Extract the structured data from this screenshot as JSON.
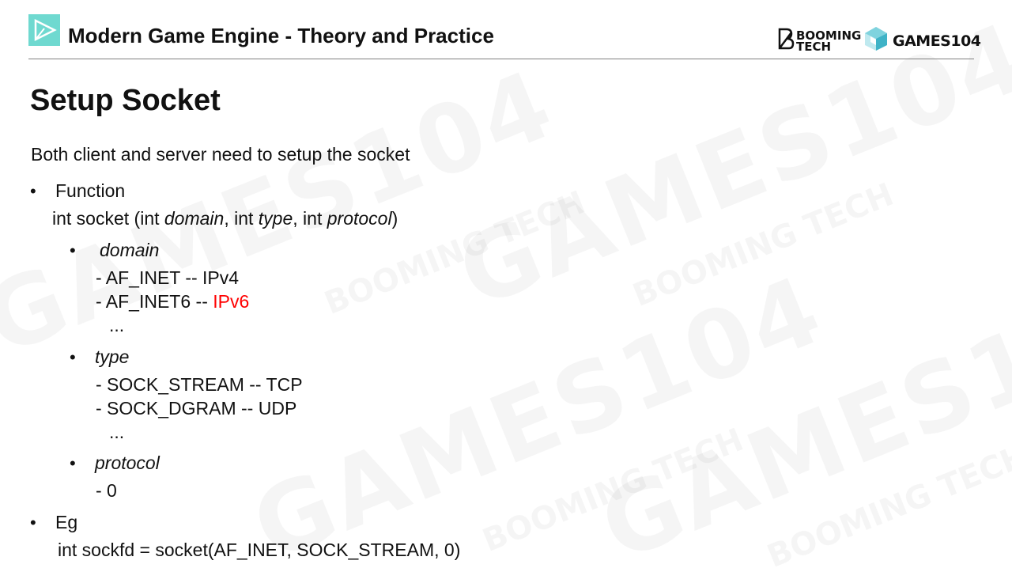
{
  "header": {
    "title": "Modern Game Engine - Theory and Practice",
    "brand_booming": "BOOMING\nTECH",
    "brand_games": "GAMES104"
  },
  "slide": {
    "title": "Setup Socket",
    "intro": "Both client and server need to setup the socket",
    "function_label": "Function",
    "signature": {
      "p1": "int socket (int ",
      "domain": "domain",
      "p2": ", int ",
      "type": "type",
      "p3": ", int ",
      "protocol": "protocol",
      "p4": ")"
    },
    "domain_label": "domain",
    "domain_items": {
      "inet": "- AF_INET -- IPv4",
      "inet6_prefix": "- AF_INET6 -- ",
      "inet6_value": "IPv6",
      "ellipsis": "..."
    },
    "type_label": "type",
    "type_items": {
      "stream": "- SOCK_STREAM -- TCP",
      "dgram": "- SOCK_DGRAM -- UDP",
      "ellipsis": "..."
    },
    "protocol_label": "protocol",
    "protocol_items": {
      "zero": "- 0"
    },
    "eg_label": "Eg",
    "eg_code": "int sockfd = socket(AF_INET, SOCK_STREAM, 0)"
  },
  "bullet_char": "•",
  "watermark": {
    "big": "GAMES104",
    "small": "BOOMING\nTECH"
  },
  "colors": {
    "accent_logo": "#6fd9d0",
    "highlight": "#ff0000",
    "rule": "#7f7f7f"
  },
  "icons": {
    "header_logo": "play-triangle-icon",
    "booming_logo": "booming-b-icon",
    "games_logo": "cube-icon"
  }
}
